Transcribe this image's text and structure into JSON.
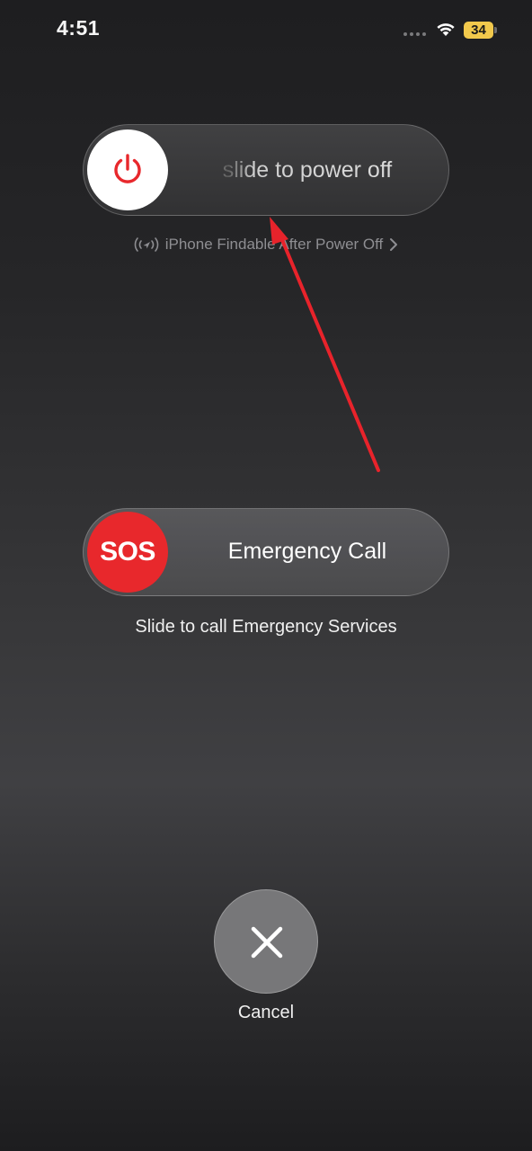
{
  "status_bar": {
    "time": "4:51",
    "battery_level": "34",
    "icons": [
      "signal-dots-icon",
      "wifi-icon",
      "battery-icon"
    ]
  },
  "power_slider": {
    "label": "slide to power off",
    "knob_icon": "power-icon",
    "icon_color": "#e8282c"
  },
  "findable": {
    "icon": "find-my-icon",
    "text": "iPhone Findable After Power Off",
    "chevron_icon": "chevron-right-icon"
  },
  "sos_slider": {
    "knob_label": "SOS",
    "label": "Emergency Call",
    "caption": "Slide to call Emergency Services",
    "knob_color": "#e8282c"
  },
  "cancel": {
    "icon": "close-icon",
    "label": "Cancel"
  },
  "annotation": {
    "arrow_color": "#e8232b"
  }
}
